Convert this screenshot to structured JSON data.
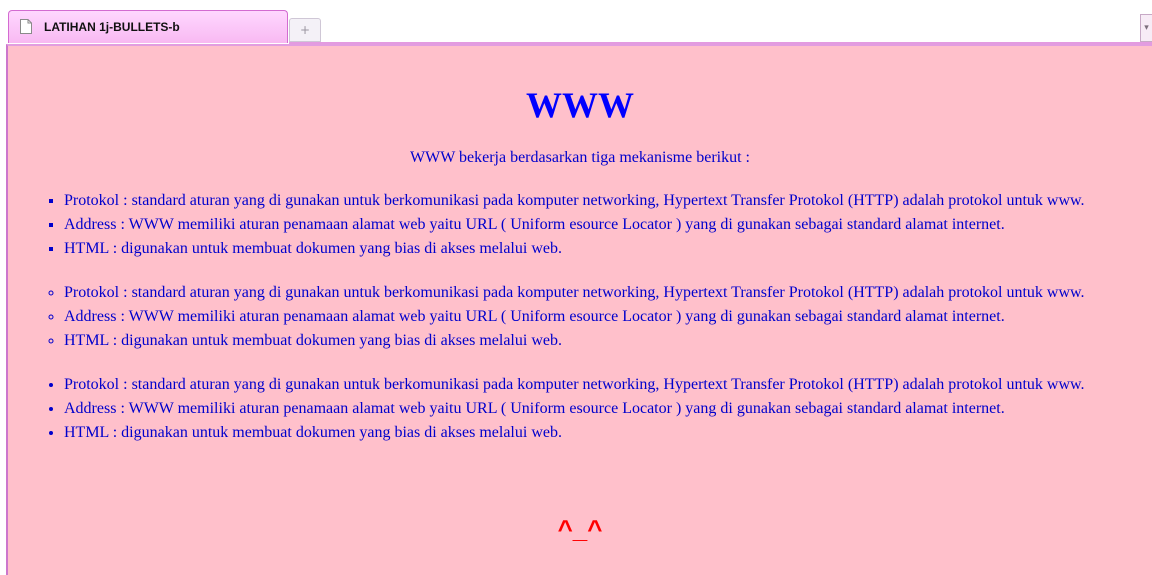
{
  "tab": {
    "title": "LATIHAN 1j-BULLETS-b",
    "new_tab_symbol": "+",
    "list_all_symbol": "▾"
  },
  "page": {
    "background": "#ffc0cb",
    "text_color": "#0000cc",
    "title": "WWW",
    "intro": "WWW bekerja berdasarkan tiga mekanisme berikut :",
    "square_list": [
      "Protokol : standard aturan yang di gunakan untuk berkomunikasi pada komputer networking, Hypertext Transfer Protokol (HTTP) adalah protokol untuk www.",
      "Address : WWW memiliki aturan penamaan alamat web yaitu URL ( Uniform esource Locator ) yang di gunakan sebagai standard alamat internet.",
      "HTML : digunakan untuk membuat dokumen yang bias di akses melalui web."
    ],
    "circle_list": [
      "Protokol : standard aturan yang di gunakan untuk berkomunikasi pada komputer networking, Hypertext Transfer Protokol (HTTP) adalah protokol untuk www.",
      "Address : WWW memiliki aturan penamaan alamat web yaitu URL ( Uniform esource Locator ) yang di gunakan sebagai standard alamat internet.",
      "HTML : digunakan untuk membuat dokumen yang bias di akses melalui web."
    ],
    "disc_list": [
      "Protokol : standard aturan yang di gunakan untuk berkomunikasi pada komputer networking, Hypertext Transfer Protokol (HTTP) adalah protokol untuk www.",
      "Address : WWW memiliki aturan penamaan alamat web yaitu URL ( Uniform esource Locator ) yang di gunakan sebagai standard alamat internet.",
      "HTML : digunakan untuk membuat dokumen yang bias di akses melalui web."
    ],
    "face": "^_^"
  },
  "icons": {
    "tab_icon": "document-icon"
  }
}
